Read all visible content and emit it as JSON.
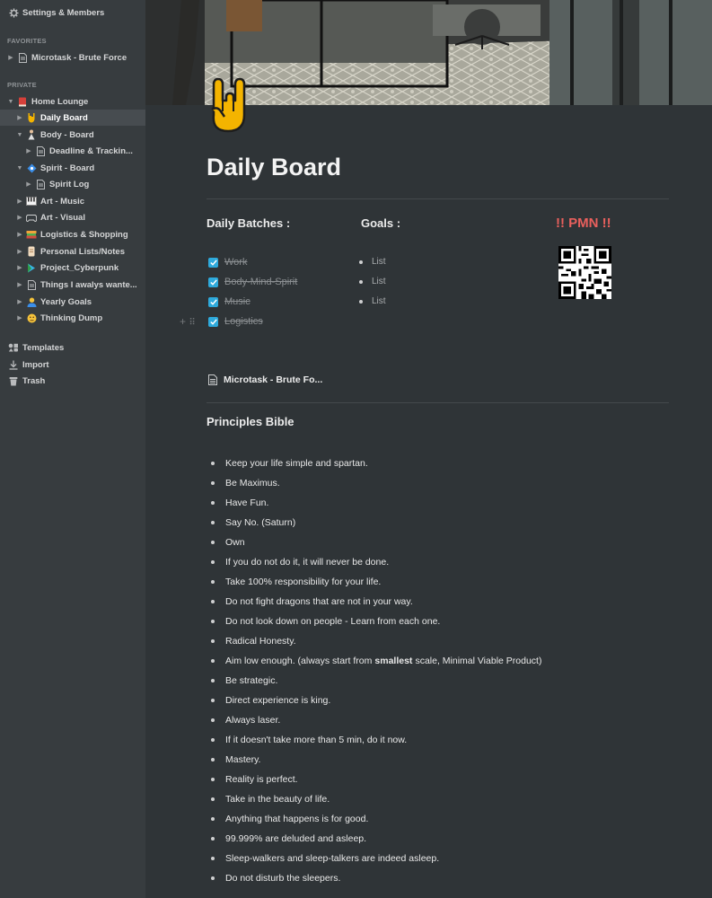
{
  "sidebar": {
    "settings_label": "Settings & Members",
    "favorites_header": "FAVORITES",
    "favorites": [
      {
        "label": "Microtask - Brute Force",
        "icon": "page-icon"
      }
    ],
    "private_header": "PRIVATE",
    "items": [
      {
        "label": "Home Lounge",
        "icon": "red-book-icon"
      },
      {
        "label": "Daily Board",
        "icon": "rock-hand-icon"
      },
      {
        "label": "Body - Board",
        "icon": "person-icon"
      },
      {
        "label": "Deadline & Trackin...",
        "icon": "page-icon"
      },
      {
        "label": "Spirit - Board",
        "icon": "diamond-icon"
      },
      {
        "label": "Spirit Log",
        "icon": "page-icon"
      },
      {
        "label": "Art - Music",
        "icon": "piano-icon"
      },
      {
        "label": "Art - Visual",
        "icon": "gamepad-icon"
      },
      {
        "label": "Logistics & Shopping",
        "icon": "books-icon"
      },
      {
        "label": "Personal Lists/Notes",
        "icon": "scroll-icon"
      },
      {
        "label": "Project_Cyberpunk",
        "icon": "play-icon"
      },
      {
        "label": "Things I awalys wante...",
        "icon": "page-icon"
      },
      {
        "label": "Yearly Goals",
        "icon": "person-yellow-icon"
      },
      {
        "label": "Thinking Dump",
        "icon": "thinking-face-icon"
      }
    ],
    "templates_label": "Templates",
    "import_label": "Import",
    "trash_label": "Trash"
  },
  "page": {
    "title": "Daily Board",
    "daily_batches_label": "Daily Batches :",
    "goals_label": "Goals :",
    "pmn_label": "!! PMN !!",
    "todos": [
      "Work",
      "Body-Mind-Spirit",
      "Music",
      "Logistics"
    ],
    "goals": [
      "List",
      "List",
      "List"
    ],
    "linked_page": "Microtask - Brute Fo...",
    "principles_title": "Principles Bible",
    "principles": [
      "Keep your life simple and spartan.",
      "Be Maximus.",
      "Have Fun.",
      "Say No. (Saturn)",
      "Own",
      "If you do not do it, it will never be done.",
      "Take 100% responsibility for your life.",
      "Do not fight dragons that are not in your way.",
      "Do not look down on people - Learn from each one.",
      "Radical Honesty.",
      "Aim low enough. (always start from smallest scale, Minimal Viable Product)",
      "Be strategic.",
      "Direct experience is king.",
      "Always laser.",
      "If it doesn't take more than 5 min, do it now.",
      "Mastery.",
      "Reality is perfect.",
      "Take in the beauty of life.",
      "Anything that happens is for good.",
      "99.999% are deluded and asleep.",
      "Sleep-walkers and sleep-talkers are indeed asleep.",
      "Do not disturb the sleepers."
    ],
    "principle_11_parts": [
      "Aim low enough. (always start from",
      "smallest",
      "scale, Minimal Viable Product)"
    ]
  },
  "colors": {
    "accent": "#2eaadc",
    "pmn": "#e9605d",
    "background": "#2f3437",
    "sidebar": "#373c3f"
  }
}
